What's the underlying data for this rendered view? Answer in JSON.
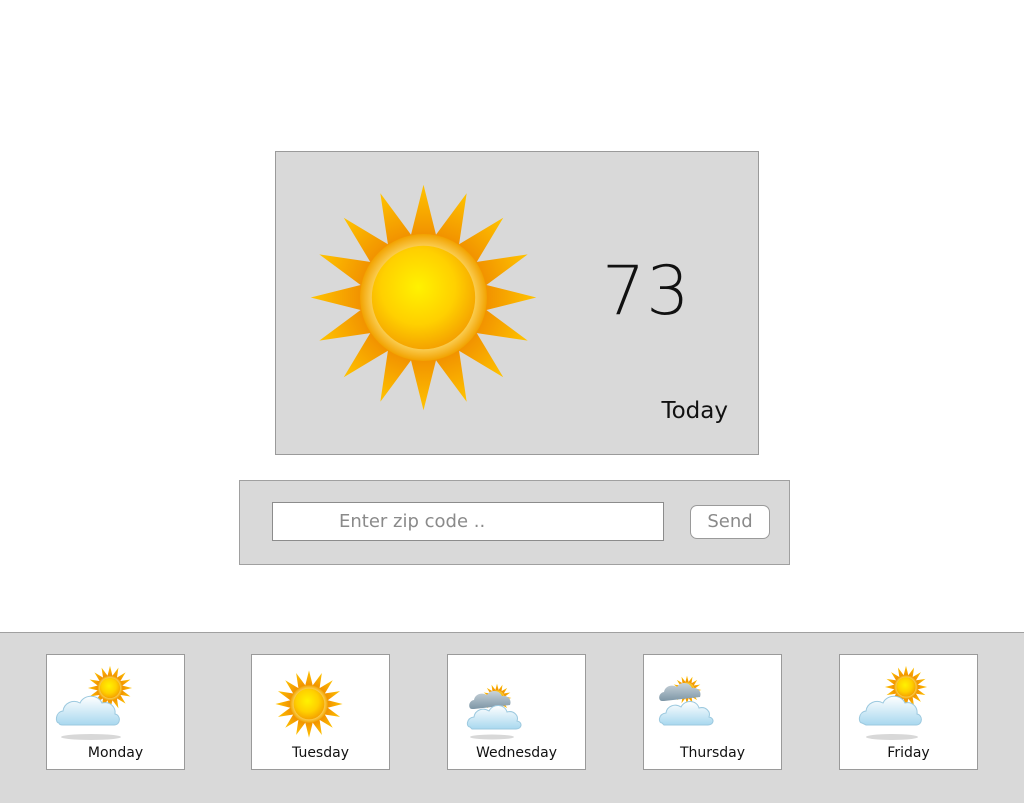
{
  "today": {
    "temperature": "73",
    "label": "Today",
    "icon": "sun-icon"
  },
  "zip": {
    "placeholder": "Enter zip code ..",
    "value": "",
    "send_label": "Send"
  },
  "forecast": [
    {
      "day": "Monday",
      "icon": "partly-cloudy-icon"
    },
    {
      "day": "Tuesday",
      "icon": "sun-icon"
    },
    {
      "day": "Wednesday",
      "icon": "cloudy-rain-icon"
    },
    {
      "day": "Thursday",
      "icon": "cloudy-rain-icon"
    },
    {
      "day": "Friday",
      "icon": "partly-cloudy-icon"
    }
  ],
  "colors": {
    "panel_bg": "#d9d9d9",
    "sun_outer": "#f6a800",
    "sun_inner": "#ffd400",
    "cloud": "#bfe3f5"
  }
}
